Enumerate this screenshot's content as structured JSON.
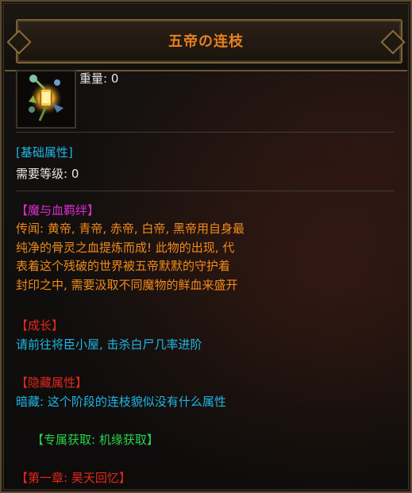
{
  "header": {
    "title": "五帝の连枝"
  },
  "item": {
    "icon": "lantern-staff-icon",
    "weight": "重量: 0"
  },
  "basic": {
    "heading": "[基础属性]",
    "level_req": "需要等级: 0"
  },
  "lore": {
    "heading": "【魔与血羁绊】",
    "lines": [
      "传闻: 黄帝, 青帝, 赤帝, 白帝, 黑帝用自身最",
      "纯净的骨灵之血提炼而成! 此物的出现, 代",
      "表着这个残破的世界被五帝默默的守护着",
      "封印之中, 需要汲取不同魔物的鲜血来盛开"
    ]
  },
  "growth": {
    "heading": "【成长】",
    "text": "请前往将臣小屋, 击杀白尸几率进阶"
  },
  "hidden": {
    "heading": "【隐藏属性】",
    "text": "暗藏: 这个阶段的连枝貌似没有什么属性"
  },
  "source": {
    "text": "【专属获取: 机缘获取】"
  },
  "chapter": {
    "text": "【第一章: 昊天回忆】"
  },
  "colors": {
    "title": "#e6801f",
    "cyan": "#1fb7e6",
    "magenta": "#e02bd0",
    "orange": "#f08a1c",
    "red": "#e8261d",
    "green": "#2ad34a"
  }
}
